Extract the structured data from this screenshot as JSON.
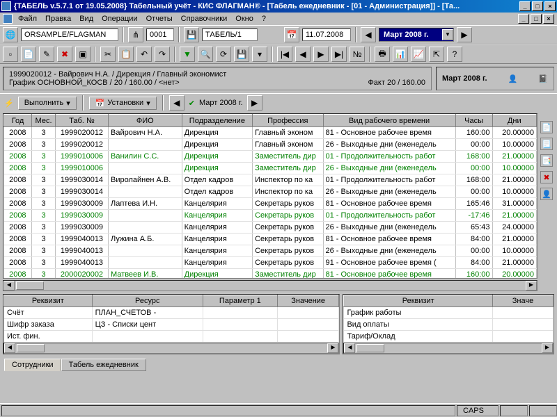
{
  "title": "{ТАБЕЛЬ v.5.7.1 от 19.05.2008} Табельный учёт - КИС ФЛАГМАН® - [Табель ежедневник - [01 - Администрация]] - [Та...",
  "menu": [
    "Файл",
    "Правка",
    "Вид",
    "Операции",
    "Отчеты",
    "Справочники",
    "Окно",
    "?"
  ],
  "tb": {
    "db": "ORSAMPLE/FLAGMAN",
    "code": "0001",
    "sheet": "ТАБЕЛЬ/1",
    "date": "11.07.2008",
    "period": "Март 2008 г."
  },
  "header": {
    "line1": "1999020012 - Вайрович Н.А.  /  Дирекция  /  Главный экономист",
    "line2": "График ОСНОВНОЙ_КОСВ / 20 / 160.00 / <нет>",
    "fact": "Факт 20 / 160.00",
    "period": "Март 2008 г."
  },
  "actions": {
    "run": "Выполнить",
    "settings": "Установки",
    "period": "Март 2008 г."
  },
  "cols": [
    "Год",
    "Мес.",
    "Таб. №",
    "ФИО",
    "Подразделение",
    "Профессия",
    "Вид рабочего времени",
    "Часы",
    "Дни"
  ],
  "rows": [
    {
      "y": "2008",
      "m": "3",
      "tab": "1999020012",
      "fio": "Вайрович Н.А.",
      "dep": "Дирекция",
      "prof": "Главный эконом",
      "vrt": "81 - Основное рабочее время",
      "hrs": "160:00",
      "days": "20.00000",
      "g": 0
    },
    {
      "y": "2008",
      "m": "3",
      "tab": "1999020012",
      "fio": "",
      "dep": "Дирекция",
      "prof": "Главный эконом",
      "vrt": "26 - Выходные дни (еженедель",
      "hrs": "00:00",
      "days": "10.00000",
      "g": 0
    },
    {
      "y": "2008",
      "m": "3",
      "tab": "1999010006",
      "fio": "Ванилин С.С.",
      "dep": "Дирекция",
      "prof": "Заместитель дир",
      "vrt": "01 - Продолжительность работ",
      "hrs": "168:00",
      "days": "21.00000",
      "g": 1
    },
    {
      "y": "2008",
      "m": "3",
      "tab": "1999010006",
      "fio": "",
      "dep": "Дирекция",
      "prof": "Заместитель дир",
      "vrt": "26 - Выходные дни (еженедель",
      "hrs": "00:00",
      "days": "10.00000",
      "g": 1
    },
    {
      "y": "2008",
      "m": "3",
      "tab": "1999030014",
      "fio": "Виролайнен А.В.",
      "dep": "Отдел кадров",
      "prof": "Инспектор по ка",
      "vrt": "01 - Продолжительность работ",
      "hrs": "168:00",
      "days": "21.00000",
      "g": 0
    },
    {
      "y": "2008",
      "m": "3",
      "tab": "1999030014",
      "fio": "",
      "dep": "Отдел кадров",
      "prof": "Инспектор по ка",
      "vrt": "26 - Выходные дни (еженедель",
      "hrs": "00:00",
      "days": "10.00000",
      "g": 0
    },
    {
      "y": "2008",
      "m": "3",
      "tab": "1999030009",
      "fio": "Лаптева И.Н.",
      "dep": "Канцелярия",
      "prof": "Секретарь руков",
      "vrt": "81 - Основное рабочее время",
      "hrs": "165:46",
      "days": "31.00000",
      "g": 0
    },
    {
      "y": "2008",
      "m": "3",
      "tab": "1999030009",
      "fio": "",
      "dep": "Канцелярия",
      "prof": "Секретарь руков",
      "vrt": "01 - Продолжительность работ",
      "hrs": "-17:46",
      "days": "21.00000",
      "g": 1
    },
    {
      "y": "2008",
      "m": "3",
      "tab": "1999030009",
      "fio": "",
      "dep": "Канцелярия",
      "prof": "Секретарь руков",
      "vrt": "26 - Выходные дни (еженедель",
      "hrs": "65:43",
      "days": "24.00000",
      "g": 0
    },
    {
      "y": "2008",
      "m": "3",
      "tab": "1999040013",
      "fio": "Лужина А.Б.",
      "dep": "Канцелярия",
      "prof": "Секретарь руков",
      "vrt": "81 - Основное рабочее время",
      "hrs": "84:00",
      "days": "21.00000",
      "g": 0
    },
    {
      "y": "2008",
      "m": "3",
      "tab": "1999040013",
      "fio": "",
      "dep": "Канцелярия",
      "prof": "Секретарь руков",
      "vrt": "26 - Выходные дни (еженедель",
      "hrs": "00:00",
      "days": "10.00000",
      "g": 0
    },
    {
      "y": "2008",
      "m": "3",
      "tab": "1999040013",
      "fio": "",
      "dep": "Канцелярия",
      "prof": "Секретарь руков",
      "vrt": "91 - Основное рабочее время (",
      "hrs": "84:00",
      "days": "21.00000",
      "g": 0
    },
    {
      "y": "2008",
      "m": "3",
      "tab": "2000020002",
      "fio": "Матвеев И.В.",
      "dep": "Дирекция",
      "prof": "Заместитель дир",
      "vrt": "81 - Основное рабочее время",
      "hrs": "160:00",
      "days": "20.00000",
      "g": 1
    }
  ],
  "left_panel": {
    "cols": [
      "Реквизит",
      "Ресурс",
      "Параметр 1",
      "Значение"
    ],
    "rows": [
      [
        "Счёт",
        "ПЛАН_СЧЕТОВ -",
        "",
        ""
      ],
      [
        "Шифр заказа",
        "ЦЗ - Списки цент",
        "",
        ""
      ],
      [
        "Ист. фин.",
        "",
        "",
        ""
      ]
    ]
  },
  "right_panel": {
    "cols": [
      "Реквизит",
      "Значе"
    ],
    "rows": [
      [
        "График работы",
        ""
      ],
      [
        "Вид оплаты",
        ""
      ],
      [
        "Тариф/Оклад",
        ""
      ]
    ]
  },
  "tabs": [
    "Сотрудники",
    "Табель ежедневник"
  ],
  "status": {
    "caps": "CAPS"
  }
}
